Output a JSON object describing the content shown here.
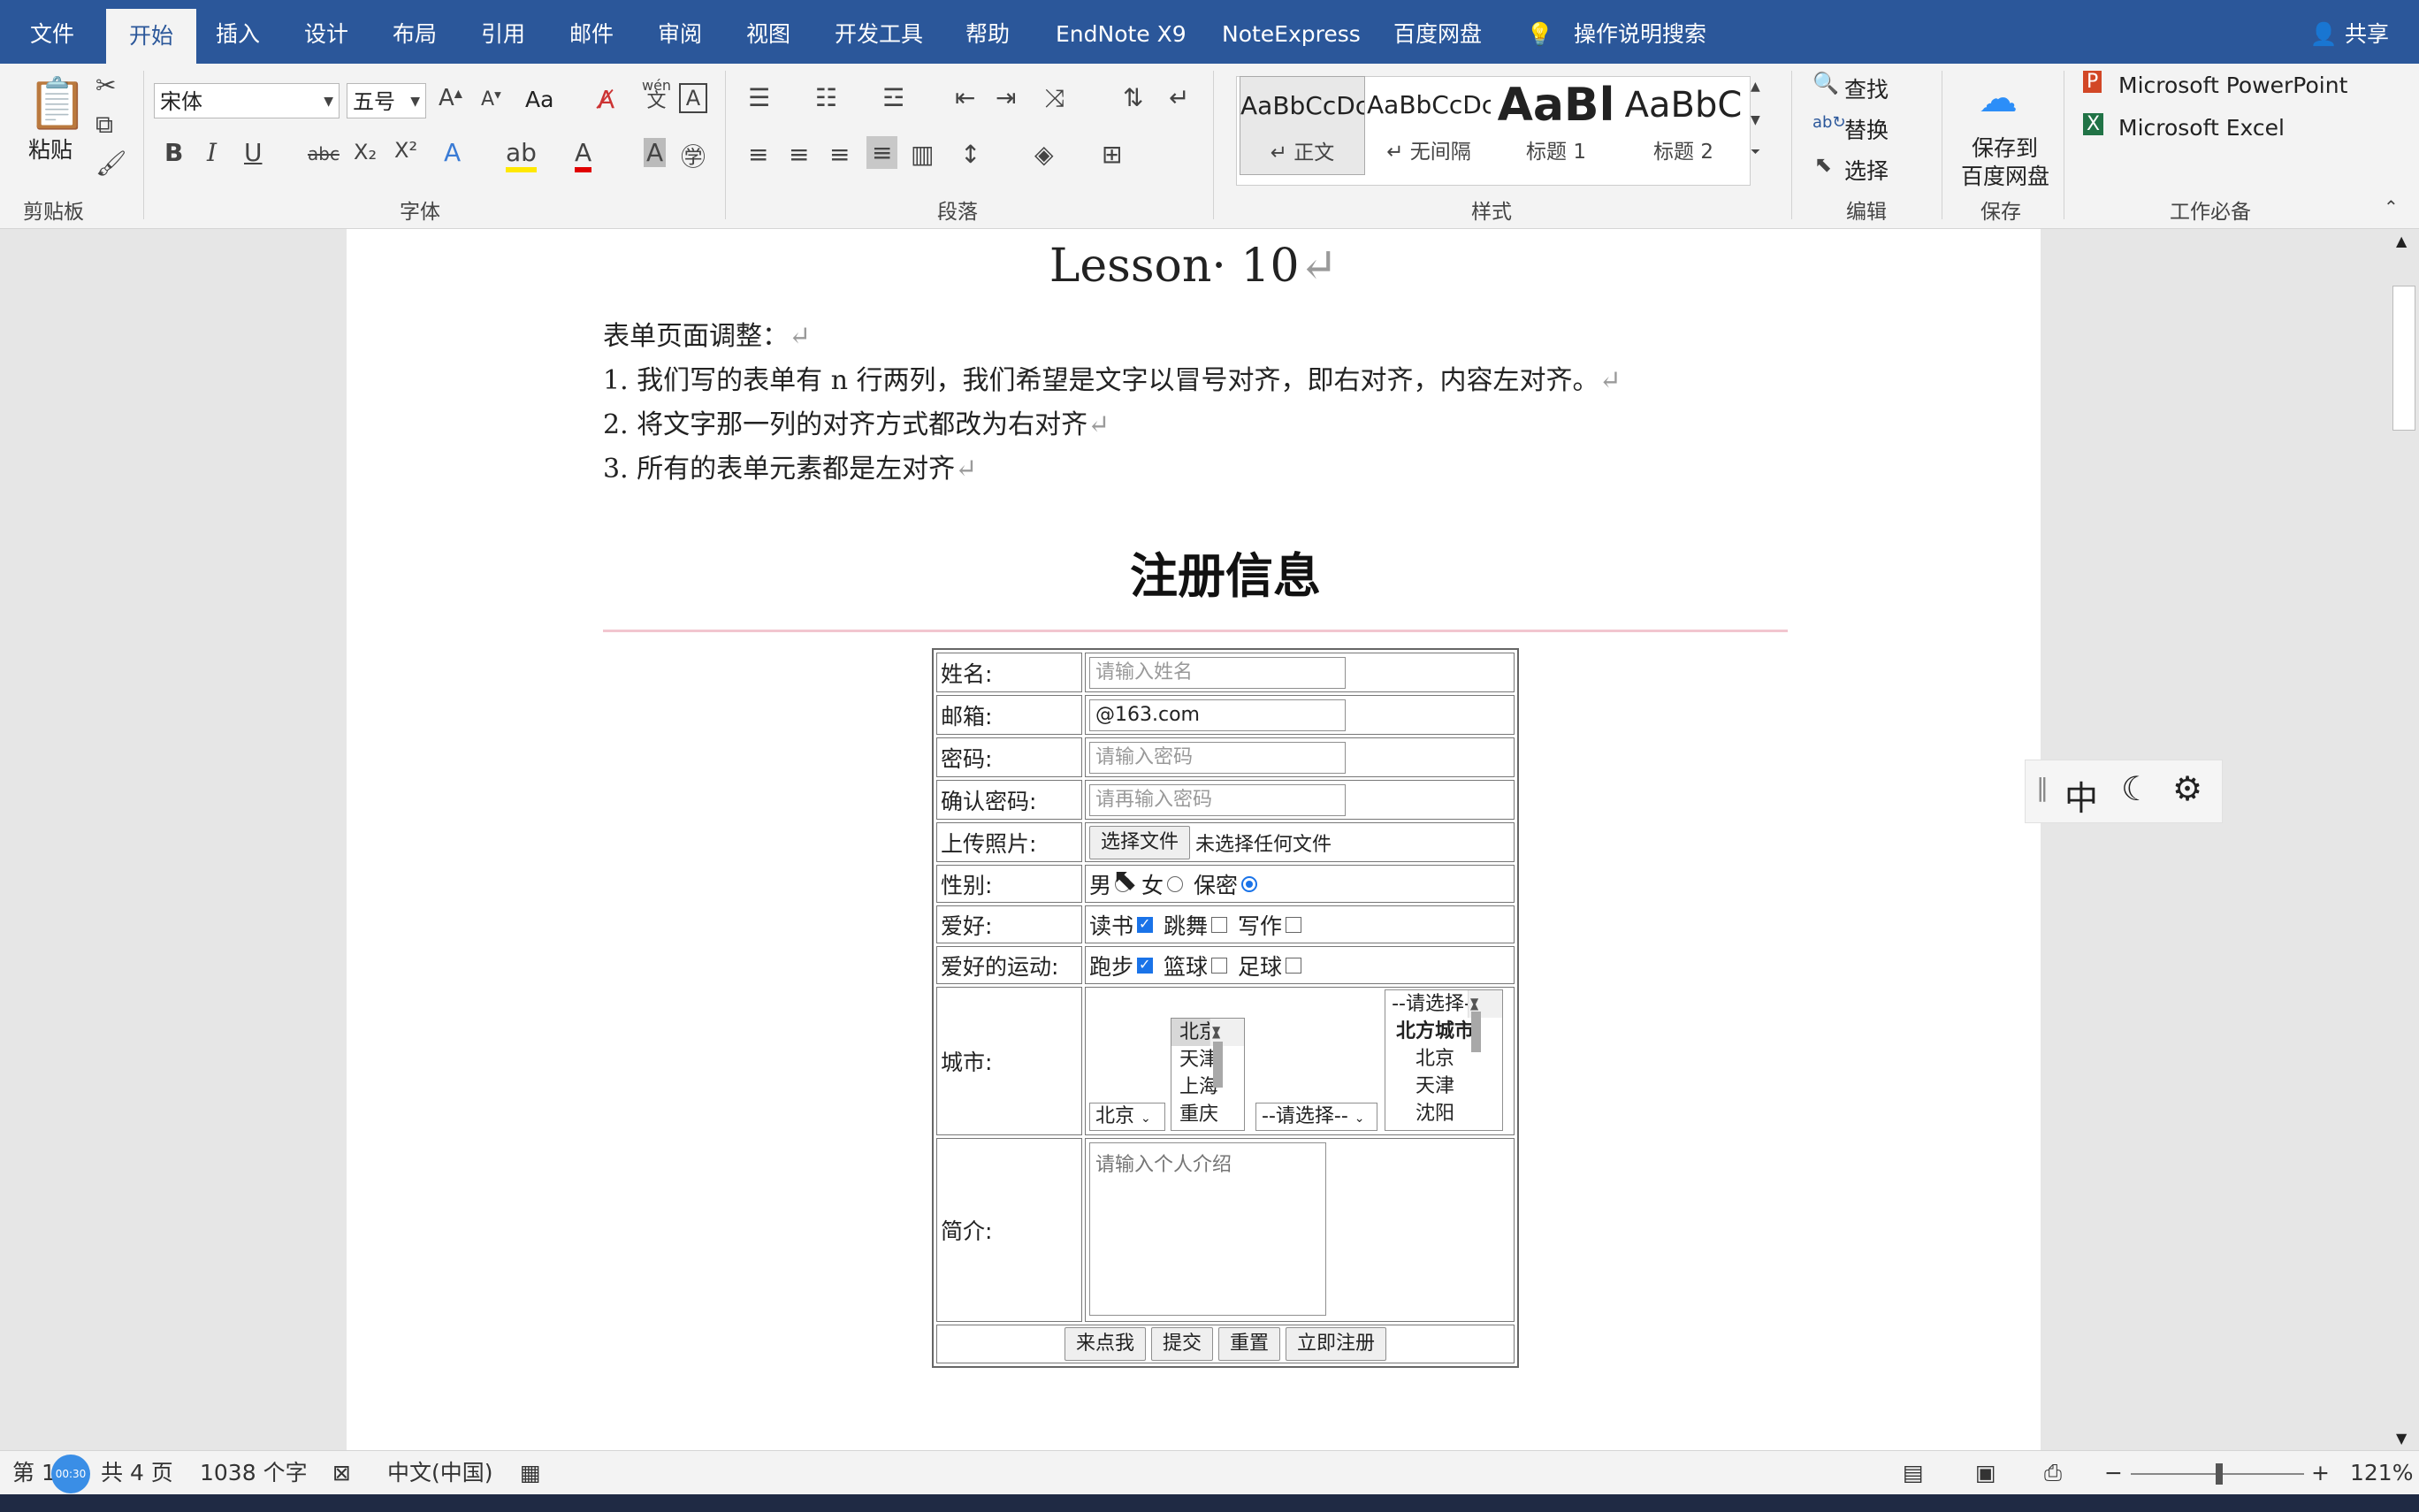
{
  "tabs": {
    "file": "文件",
    "home": "开始",
    "insert": "插入",
    "design": "设计",
    "layout": "布局",
    "references": "引用",
    "mailings": "邮件",
    "review": "审阅",
    "view": "视图",
    "developer": "开发工具",
    "help": "帮助",
    "endnote": "EndNote X9",
    "noteexpress": "NoteExpress",
    "baidu": "百度网盘",
    "tell_me": "操作说明搜索",
    "share": "共享"
  },
  "ribbon": {
    "paste": "粘贴",
    "clipboard_label": "剪贴板",
    "font_name": "宋体",
    "font_size": "五号",
    "change_case": "Aa",
    "phonetic_top": "wén",
    "phonetic_bottom": "文",
    "font_label": "字体",
    "paragraph_label": "段落",
    "styles": [
      {
        "sample": "AaBbCcDc",
        "name": "↵ 正文"
      },
      {
        "sample": "AaBbCcDc",
        "name": "↵ 无间隔"
      },
      {
        "sample": "AaBl",
        "name": "标题 1"
      },
      {
        "sample": "AaBbC",
        "name": "标题 2"
      }
    ],
    "styles_label": "样式",
    "find": "查找",
    "replace": "替换",
    "select": "选择",
    "edit_label": "编辑",
    "save_baidu_1": "保存到",
    "save_baidu_2": "百度网盘",
    "save_label": "保存",
    "powerpoint": "Microsoft PowerPoint",
    "excel": "Microsoft Excel",
    "tools_label": "工作必备"
  },
  "document": {
    "title": "Lesson· 10",
    "paragraphs": [
      "表单页面调整：",
      "1. 我们写的表单有 n 行两列，我们希望是文字以冒号对齐，即右对齐，内容左对齐。",
      "2. 将文字那一列的对齐方式都改为右对齐",
      "3. 所有的表单元素都是左对齐"
    ],
    "para_mark": "↵",
    "form_heading": "注册信息"
  },
  "form": {
    "name_label": "姓名:",
    "name_placeholder": "请输入姓名",
    "email_label": "邮箱:",
    "email_value": "@163.com",
    "password_label": "密码:",
    "password_placeholder": "请输入密码",
    "confirm_label": "确认密码:",
    "confirm_placeholder": "请再输入密码",
    "photo_label": "上传照片:",
    "choose_file": "选择文件",
    "no_file": "未选择任何文件",
    "gender_label": "性别:",
    "male": "男",
    "female": "女",
    "secret": "保密",
    "hobby_label": "爱好:",
    "hobbies": [
      "读书",
      "跳舞",
      "写作"
    ],
    "sports_label": "爱好的运动:",
    "sports": [
      "跑步",
      "篮球",
      "足球"
    ],
    "city_label": "城市:",
    "city_select": "北京",
    "city_list": [
      "北京",
      "天津",
      "上海",
      "重庆"
    ],
    "city_select2": "--请选择--",
    "city_group_list": [
      "--请选择--",
      "北方城市",
      "北京",
      "天津",
      "沈阳"
    ],
    "intro_label": "简介:",
    "intro_placeholder": "请输入个人介绍",
    "buttons": [
      "来点我",
      "提交",
      "重置",
      "立即注册"
    ]
  },
  "float_toolbar": {
    "lang": "中"
  },
  "status": {
    "page": "第 1",
    "timer": "00:30",
    "total_pages": "共 4 页",
    "words": "1038 个字",
    "language": "中文(中国)",
    "zoom": "121%"
  },
  "colors": {
    "accent": "#2b579a",
    "checkbox": "#1a73e8"
  }
}
